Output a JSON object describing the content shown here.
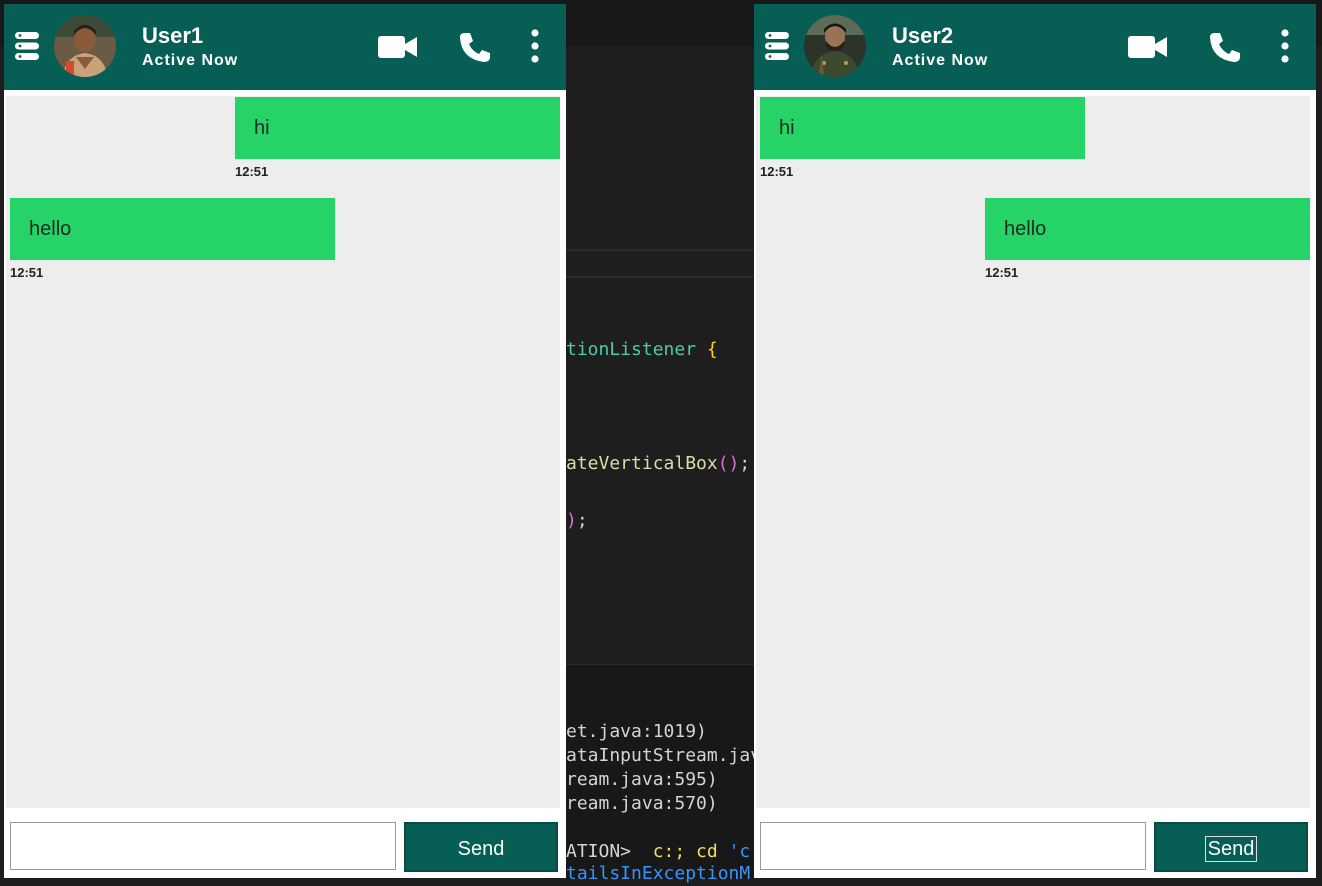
{
  "editor": {
    "code_lines": [
      {
        "parts": [
          {
            "t": "tionListener",
            "c": "c-teal"
          },
          {
            "t": " {",
            "c": "c-br"
          }
        ]
      },
      {
        "parts": [
          {
            "t": "ateVerticalBox",
            "c": "c-yel"
          },
          {
            "t": "()",
            "c": "c-pk"
          },
          {
            "t": ";",
            "c": "c-wh"
          }
        ]
      },
      {
        "parts": [
          {
            "t": ")",
            "c": "c-pk"
          },
          {
            "t": ";",
            "c": "c-wh"
          }
        ]
      }
    ],
    "terminal_lines": [
      "et.java:1019)",
      "ataInputStream.jav",
      "ream.java:595)",
      "ream.java:570)"
    ],
    "terminal_prompt": {
      "prefix": "ATION>  ",
      "cmd": "c:; cd ",
      "arg": "'c:"
    },
    "terminal_last": "tailsInExceptionM"
  },
  "chat1": {
    "user_name": "User1",
    "status": "Active Now",
    "icons": {
      "menu": "menu-icon",
      "avatar": "avatar",
      "video": "video-icon",
      "phone": "phone-icon",
      "more": "more-icon"
    },
    "messages": [
      {
        "text": "hi",
        "time": "12:51",
        "side": "right"
      },
      {
        "text": "hello",
        "time": "12:51",
        "side": "left"
      }
    ],
    "input_value": "",
    "send_label": "Send"
  },
  "chat2": {
    "user_name": "User2",
    "status": "Active Now",
    "icons": {
      "menu": "menu-icon",
      "avatar": "avatar",
      "video": "video-icon",
      "phone": "phone-icon",
      "more": "more-icon"
    },
    "messages": [
      {
        "text": "hi",
        "time": "12:51",
        "side": "left"
      },
      {
        "text": "hello",
        "time": "12:51",
        "side": "right"
      }
    ],
    "input_value": "",
    "send_label": "Send"
  },
  "colors": {
    "header": "#075e54",
    "bubble": "#25d366",
    "chat_bg": "#ededed"
  }
}
